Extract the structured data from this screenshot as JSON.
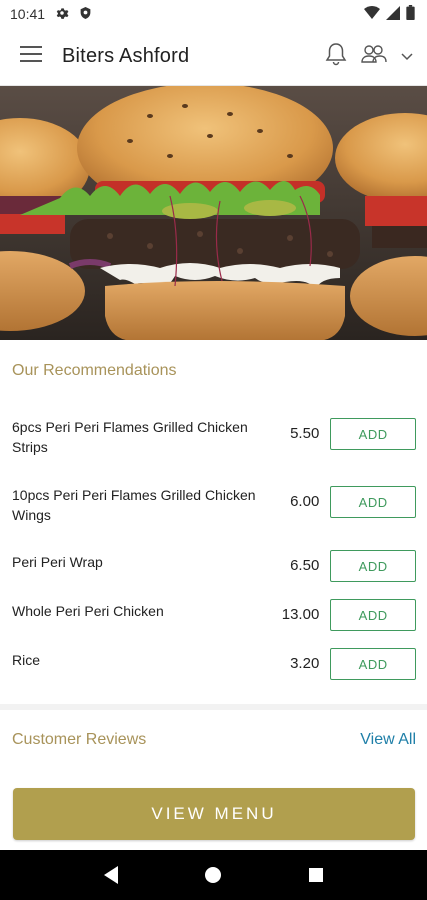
{
  "status_bar": {
    "time": "10:41",
    "icons": [
      "gear-icon",
      "shield-icon",
      "wifi-icon",
      "signal-icon",
      "battery-icon"
    ]
  },
  "app_bar": {
    "title": "Biters Ashford",
    "menu_icon": "hamburger-menu-icon",
    "notification_icon": "bell-icon",
    "account_icon": "users-icon",
    "dropdown_icon": "chevron-down-icon"
  },
  "hero": {
    "image_subject": "burgers"
  },
  "recommendations": {
    "title": "Our Recommendations",
    "items": [
      {
        "name": "6pcs Peri Peri Flames Grilled Chicken Strips",
        "price": "5.50",
        "add_label": "ADD"
      },
      {
        "name": "10pcs Peri Peri Flames Grilled Chicken Wings",
        "price": "6.00",
        "add_label": "ADD"
      },
      {
        "name": "Peri Peri Wrap",
        "price": "6.50",
        "add_label": "ADD"
      },
      {
        "name": "Whole Peri Peri Chicken",
        "price": "13.00",
        "add_label": "ADD"
      },
      {
        "name": "Rice",
        "price": "3.20",
        "add_label": "ADD"
      }
    ]
  },
  "reviews": {
    "title": "Customer Reviews",
    "view_all": "View All"
  },
  "footer": {
    "view_menu": "VIEW MENU"
  },
  "nav": {
    "icons": [
      "back-icon",
      "home-icon",
      "recents-icon"
    ]
  },
  "colors": {
    "gold": "#b19f4e",
    "gold_text": "#a8935a",
    "green": "#3f9a5d",
    "link_blue": "#1f7fa8"
  }
}
